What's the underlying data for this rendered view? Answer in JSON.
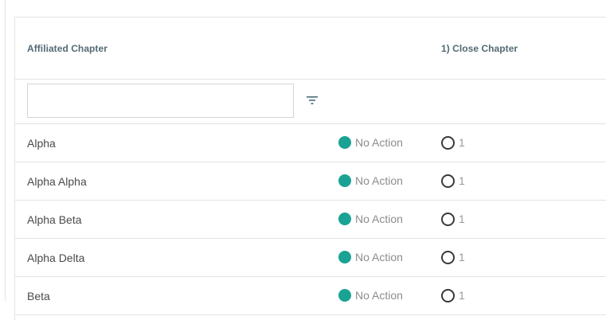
{
  "table": {
    "columns": {
      "affiliated_chapter": "Affiliated Chapter",
      "close_chapter": "1) Close Chapter"
    },
    "filter": {
      "value": "",
      "icon": "filter-icon"
    },
    "rows": [
      {
        "name": "Alpha",
        "status": "No Action",
        "vote_count": "1"
      },
      {
        "name": "Alpha Alpha",
        "status": "No Action",
        "vote_count": "1"
      },
      {
        "name": "Alpha Beta",
        "status": "No Action",
        "vote_count": "1"
      },
      {
        "name": "Alpha Delta",
        "status": "No Action",
        "vote_count": "1"
      },
      {
        "name": "Beta",
        "status": "No Action",
        "vote_count": "1"
      }
    ]
  },
  "colors": {
    "status_dot": "#1aa394",
    "header_text": "#536a73",
    "border": "#e3e3e3"
  }
}
